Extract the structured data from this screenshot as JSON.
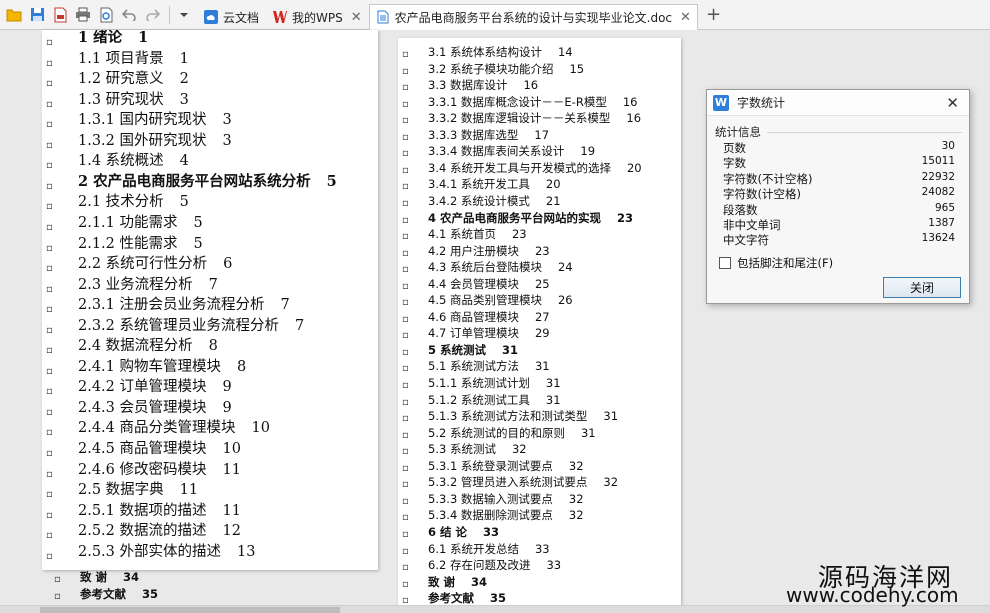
{
  "tabs": [
    {
      "label": "云文档",
      "icon": "cloud-doc-icon"
    },
    {
      "label": "我的WPS",
      "icon": "wps-logo-icon"
    },
    {
      "label": "农产品电商服务平台系统的设计与实现毕业论文.doc",
      "icon": "doc-file-icon"
    }
  ],
  "toc_left": [
    {
      "text": "1 绪论",
      "page": "1",
      "bold": true
    },
    {
      "text": "1.1 项目背景",
      "page": "1"
    },
    {
      "text": "1.2 研究意义",
      "page": "2"
    },
    {
      "text": "1.3 研究现状",
      "page": "3"
    },
    {
      "text": "1.3.1 国内研究现状",
      "page": "3"
    },
    {
      "text": "1.3.2 国外研究现状",
      "page": "3"
    },
    {
      "text": "1.4 系统概述",
      "page": "4"
    },
    {
      "text": "2 农产品电商服务平台网站系统分析",
      "page": "5",
      "bold": true
    },
    {
      "text": "2.1 技术分析",
      "page": "5"
    },
    {
      "text": "2.1.1 功能需求",
      "page": "5"
    },
    {
      "text": "2.1.2 性能需求",
      "page": "5"
    },
    {
      "text": "2.2 系统可行性分析",
      "page": "6"
    },
    {
      "text": "2.3 业务流程分析",
      "page": "7"
    },
    {
      "text": "2.3.1 注册会员业务流程分析",
      "page": "7"
    },
    {
      "text": "2.3.2 系统管理员业务流程分析",
      "page": "7"
    },
    {
      "text": "2.4 数据流程分析",
      "page": "8"
    },
    {
      "text": "2.4.1 购物车管理模块",
      "page": "8"
    },
    {
      "text": "2.4.2 订单管理模块",
      "page": "9"
    },
    {
      "text": "2.4.3 会员管理模块",
      "page": "9"
    },
    {
      "text": "2.4.4 商品分类管理模块",
      "page": "10"
    },
    {
      "text": "2.4.5 商品管理模块",
      "page": "10"
    },
    {
      "text": "2.4.6 修改密码模块",
      "page": "11"
    },
    {
      "text": "2.5 数据字典",
      "page": "11"
    },
    {
      "text": "2.5.1 数据项的描述",
      "page": "11"
    },
    {
      "text": "2.5.2 数据流的描述",
      "page": "12"
    },
    {
      "text": "2.5.3 外部实体的描述",
      "page": "13"
    }
  ],
  "toc_below_left": [
    {
      "text": "致 谢",
      "page": "34"
    },
    {
      "text": "参考文献",
      "page": "35"
    }
  ],
  "toc_right": [
    {
      "text": "3.1 系统体系结构设计",
      "page": "14"
    },
    {
      "text": "3.2 系统子模块功能介绍",
      "page": "15"
    },
    {
      "text": "3.3 数据库设计",
      "page": "16"
    },
    {
      "text": "3.3.1 数据库概念设计－－E-R模型",
      "page": "16"
    },
    {
      "text": "3.3.2 数据库逻辑设计－－关系模型",
      "page": "16"
    },
    {
      "text": "3.3.3 数据库选型",
      "page": "17"
    },
    {
      "text": "3.3.4 数据库表间关系设计",
      "page": "19"
    },
    {
      "text": "3.4 系统开发工具与开发模式的选择",
      "page": "20"
    },
    {
      "text": "3.4.1 系统开发工具",
      "page": "20"
    },
    {
      "text": "3.4.2 系统设计模式",
      "page": "21"
    },
    {
      "text": "4 农产品电商服务平台网站的实现",
      "page": "23",
      "bold": true
    },
    {
      "text": "4.1 系统首页",
      "page": "23"
    },
    {
      "text": "4.2 用户注册模块",
      "page": "23"
    },
    {
      "text": "4.3 系统后台登陆模块",
      "page": "24"
    },
    {
      "text": "4.4 会员管理模块",
      "page": "25"
    },
    {
      "text": "4.5 商品类别管理模块",
      "page": "26"
    },
    {
      "text": "4.6 商品管理模块",
      "page": "27"
    },
    {
      "text": "4.7 订单管理模块",
      "page": "29"
    },
    {
      "text": "5 系统测试",
      "page": "31",
      "bold": true
    },
    {
      "text": "5.1 系统测试方法",
      "page": "31"
    },
    {
      "text": "5.1.1 系统测试计划",
      "page": "31"
    },
    {
      "text": "5.1.2 系统测试工具",
      "page": "31"
    },
    {
      "text": "5.1.3 系统测试方法和测试类型",
      "page": "31"
    },
    {
      "text": "5.2 系统测试的目的和原则",
      "page": "31"
    },
    {
      "text": "5.3 系统测试",
      "page": "32"
    },
    {
      "text": "5.3.1 系统登录测试要点",
      "page": "32"
    },
    {
      "text": "5.3.2 管理员进入系统测试要点",
      "page": "32"
    },
    {
      "text": "5.3.3 数据输入测试要点",
      "page": "32"
    },
    {
      "text": "5.3.4 数据删除测试要点",
      "page": "32"
    },
    {
      "text": "6 结 论",
      "page": "33",
      "bold": true
    },
    {
      "text": "6.1 系统开发总结",
      "page": "33"
    },
    {
      "text": "6.2 存在问题及改进",
      "page": "33"
    },
    {
      "text": "致 谢",
      "page": "34",
      "bold": true
    },
    {
      "text": "参考文献",
      "page": "35",
      "bold": true
    }
  ],
  "dialog": {
    "title": "字数统计",
    "group_label": "统计信息",
    "stats": [
      {
        "label": "页数",
        "value": "30"
      },
      {
        "label": "字数",
        "value": "15011"
      },
      {
        "label": "字符数(不计空格)",
        "value": "22932"
      },
      {
        "label": "字符数(计空格)",
        "value": "24082"
      },
      {
        "label": "段落数",
        "value": "965"
      },
      {
        "label": "非中文单词",
        "value": "1387"
      },
      {
        "label": "中文字符",
        "value": "13624"
      }
    ],
    "checkbox_label": "包括脚注和尾注(F)",
    "close_button": "关闭"
  },
  "watermark": {
    "line1": "源码海洋网",
    "line2": "www.codehy.com"
  },
  "colors": {
    "accent": "#2f7ed8",
    "wps_red": "#d7261e"
  }
}
